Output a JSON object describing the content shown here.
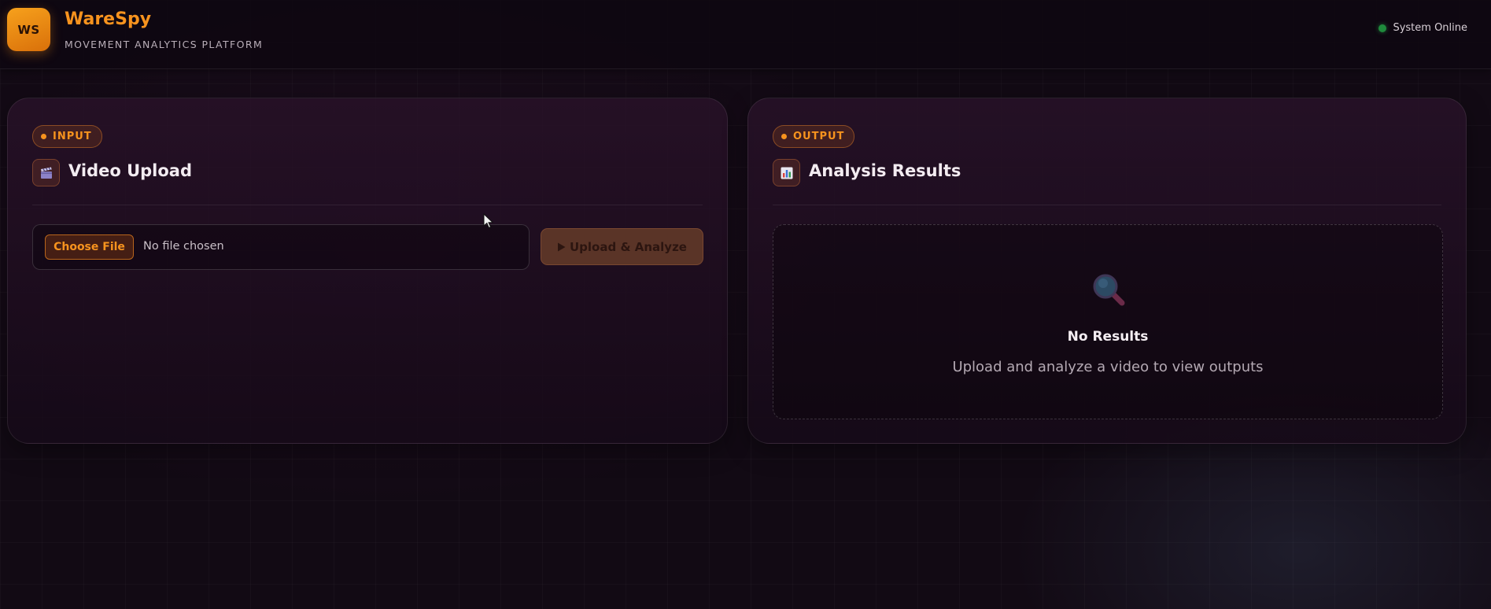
{
  "header": {
    "logo_text": "WS",
    "brand_title": "WareSpy",
    "brand_subtitle": "MOVEMENT ANALYTICS PLATFORM",
    "status_text": "System Online",
    "status_color": "#1f8a3c"
  },
  "input_panel": {
    "tag": "INPUT",
    "icon": "clapperboard-icon",
    "title": "Video Upload",
    "choose_file_label": "Choose File",
    "file_name": "No file chosen",
    "upload_button_label": "Upload & Analyze",
    "upload_button_icon": "play-icon"
  },
  "output_panel": {
    "tag": "OUTPUT",
    "icon": "bar-chart-icon",
    "title": "Analysis Results",
    "empty_icon": "magnifier-icon",
    "empty_title": "No Results",
    "empty_message": "Upload and analyze a video to view outputs"
  },
  "colors": {
    "accent": "#f7931e",
    "background": "#120a14"
  }
}
